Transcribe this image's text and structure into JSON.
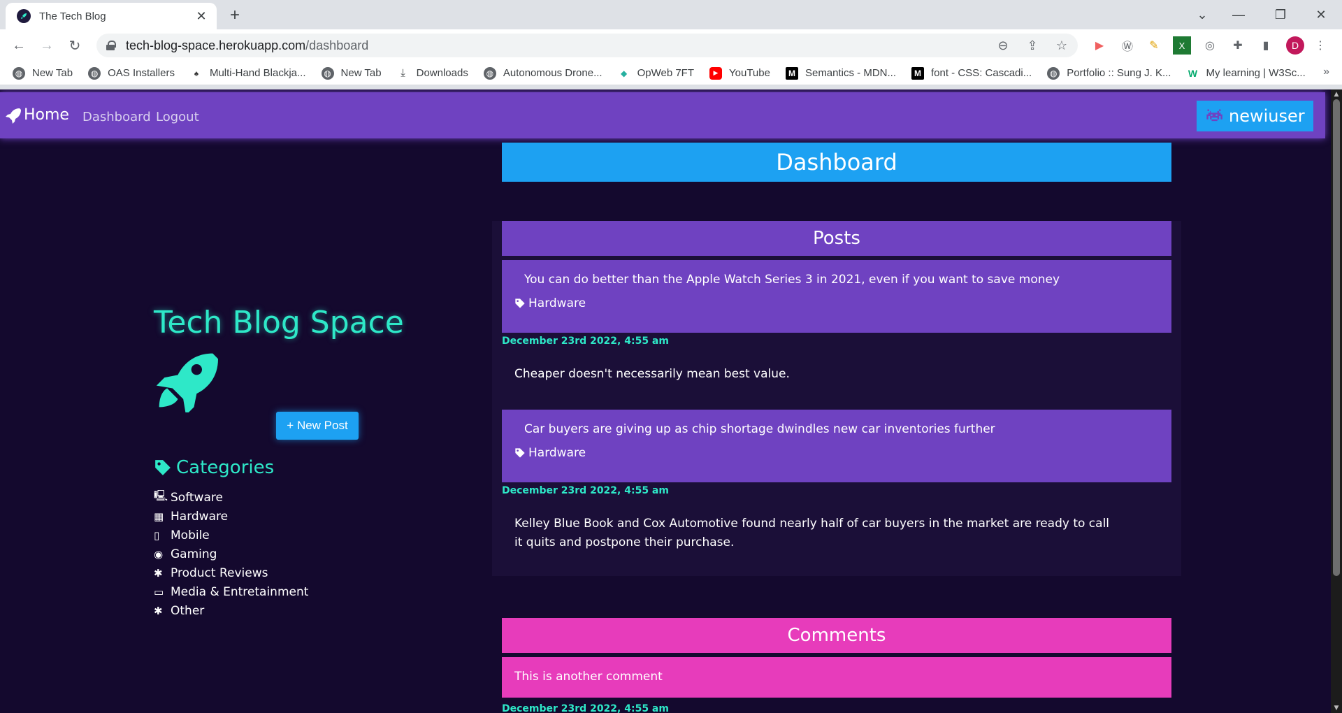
{
  "browser": {
    "tab_title": "The Tech Blog",
    "url_host": "tech-blog-space.herokuapp.com",
    "url_path": "/dashboard",
    "profile_initial": "D",
    "bookmarks": [
      {
        "label": "New Tab",
        "icon": "globe-icon"
      },
      {
        "label": "OAS Installers",
        "icon": "globe-icon"
      },
      {
        "label": "Multi-Hand Blackja...",
        "icon": "cards-icon"
      },
      {
        "label": "New Tab",
        "icon": "globe-icon"
      },
      {
        "label": "Downloads",
        "icon": "download-icon"
      },
      {
        "label": "Autonomous Drone...",
        "icon": "globe-icon"
      },
      {
        "label": "OpWeb 7FT",
        "icon": "opweb-icon"
      },
      {
        "label": "YouTube",
        "icon": "youtube-icon"
      },
      {
        "label": "Semantics - MDN...",
        "icon": "mdn-icon"
      },
      {
        "label": "font - CSS: Cascadi...",
        "icon": "mdn-icon"
      },
      {
        "label": "Portfolio :: Sung J. K...",
        "icon": "globe-icon"
      },
      {
        "label": "My learning | W3Sc...",
        "icon": "w3schools-icon"
      }
    ]
  },
  "navbar": {
    "home_label": "Home",
    "links": [
      "Dashboard",
      "Logout"
    ],
    "username": "newiuser"
  },
  "sidebar": {
    "brand_title": "Tech Blog Space",
    "new_post_label": "+ New Post",
    "categories_heading": "Categories",
    "categories": [
      {
        "label": "Software",
        "icon": "desktop-icon"
      },
      {
        "label": "Hardware",
        "icon": "chip-icon"
      },
      {
        "label": "Mobile",
        "icon": "mobile-icon"
      },
      {
        "label": "Gaming",
        "icon": "gamepad-icon"
      },
      {
        "label": "Product Reviews",
        "icon": "bug-icon"
      },
      {
        "label": "Media & Entretainment",
        "icon": "tv-icon"
      },
      {
        "label": "Other",
        "icon": "asterisk-icon"
      }
    ]
  },
  "main": {
    "dashboard_title": "Dashboard",
    "posts_heading": "Posts",
    "posts": [
      {
        "title": "You can do better than the Apple Watch Series 3 in 2021, even if you want to save money",
        "tag": "Hardware",
        "date": "December 23rd 2022, 4:55 am",
        "body": "Cheaper doesn't necessarily mean best value."
      },
      {
        "title": "Car buyers are giving up as chip shortage dwindles new car inventories further",
        "tag": "Hardware",
        "date": "December 23rd 2022, 4:55 am",
        "body": "Kelley Blue Book and Cox Automotive found nearly half of car buyers in the market are ready to call it quits and postpone their purchase."
      }
    ],
    "comments_heading": "Comments",
    "comments": [
      {
        "text": "This is another comment",
        "date": "December 23rd 2022, 4:55 am"
      }
    ]
  },
  "colors": {
    "page_bg": "#14092e",
    "navbar": "#6f42c1",
    "accent_blue": "#1da1f2",
    "accent_teal": "#2ee8c8",
    "comments_pink": "#e73cbb"
  }
}
